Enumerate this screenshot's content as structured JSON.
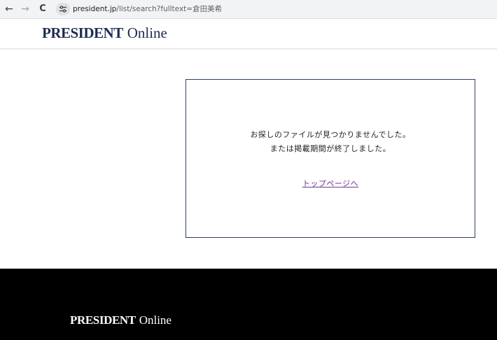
{
  "browser": {
    "back_icon": "←",
    "forward_icon": "→",
    "reload_icon": "C",
    "url_host": "president.jp",
    "url_rest": "/list/search?fulltext=倉田美希"
  },
  "header": {
    "logo_brand": "PRESIDENT",
    "logo_suffix": "Online"
  },
  "main": {
    "message_line1": "お探しのファイルが見つかりませんでした。",
    "message_line2": "または掲載期間が終了しました。",
    "top_link_label": "トップページへ"
  },
  "footer": {
    "logo_brand": "PRESIDENT",
    "logo_suffix": "Online"
  },
  "colors": {
    "brand_navy": "#1c2b4f",
    "box_border": "#2e3f66",
    "link": "#6b3a8a",
    "footer_bg": "#000000"
  }
}
